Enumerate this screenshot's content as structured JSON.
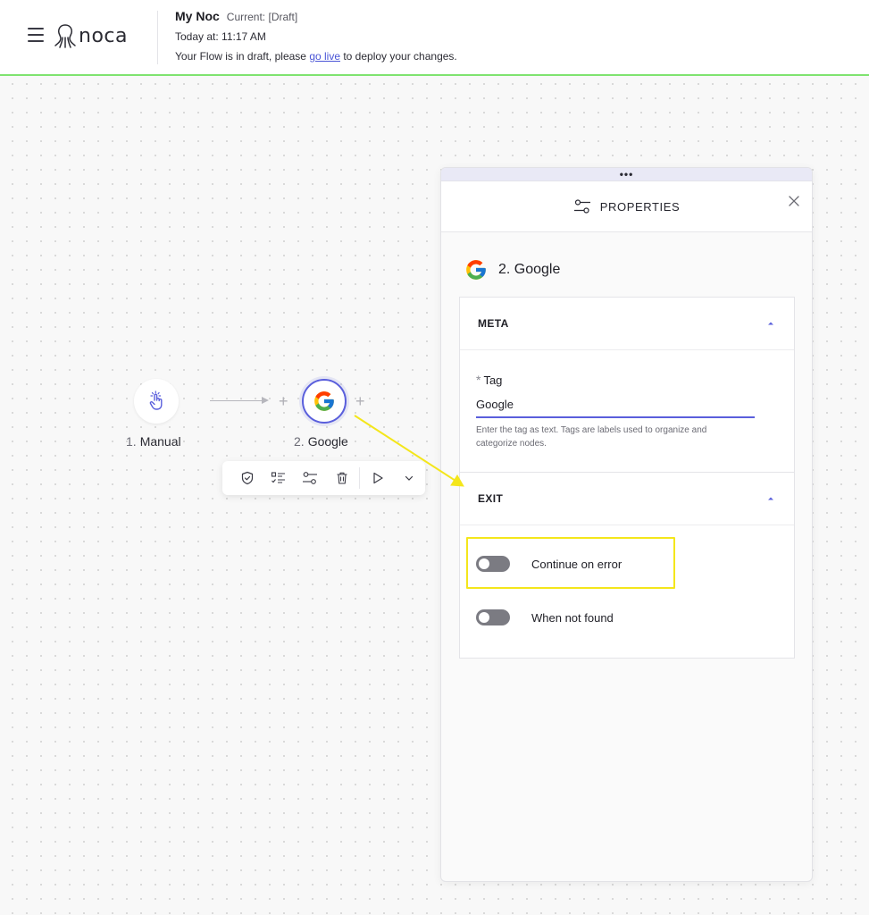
{
  "header": {
    "app_name": "noca",
    "flow_title": "My Noc",
    "flow_version": "Current: [Draft]",
    "flow_time": "Today at: 11:17 AM",
    "draft_msg_before": "Your Flow is in draft, please ",
    "draft_msg_link": "go live",
    "draft_msg_after": " to deploy your changes.",
    "accent_color": "#7ee36f"
  },
  "canvas": {
    "nodes": [
      {
        "num": "1.",
        "label": "Manual",
        "icon": "hand-pointer-icon"
      },
      {
        "num": "2.",
        "label": "Google",
        "icon": "google-icon"
      }
    ],
    "toolbar": [
      "shield-check-icon",
      "list-check-icon",
      "sliders-icon",
      "trash-icon",
      "play-icon",
      "chevron-down-icon"
    ]
  },
  "panel": {
    "title": "PROPERTIES",
    "node_title": "2. Google",
    "meta": {
      "title": "META",
      "required_mark": "*",
      "tag_label": "Tag",
      "tag_value": "Google",
      "help": "Enter the tag as text. Tags are labels used to organize and categorize nodes."
    },
    "exit": {
      "title": "EXIT",
      "toggles": [
        {
          "label": "Continue on error",
          "enabled": false
        },
        {
          "label": "When not found",
          "enabled": false
        }
      ]
    },
    "accent_color": "#5a5fdc"
  },
  "annotation_color": "#f4e61b"
}
